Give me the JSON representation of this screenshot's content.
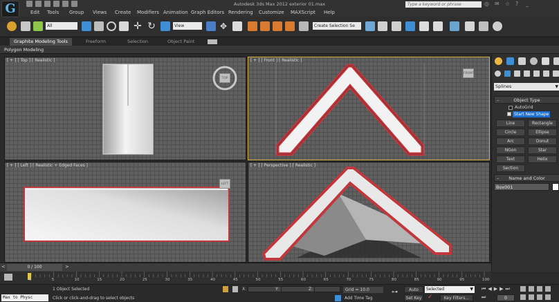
{
  "window": {
    "title": "Autodesk 3ds Max 2012    exterior 01.max",
    "search_placeholder": "Type a keyword or phrase"
  },
  "menu": {
    "items": [
      "Edit",
      "Tools",
      "Group",
      "Views",
      "Create",
      "Modifiers",
      "Animation",
      "Graph Editors",
      "Rendering",
      "Customize",
      "MAXScript",
      "Help"
    ]
  },
  "toolbar": {
    "filter_value": "All",
    "view_value": "View",
    "selection_set_placeholder": "Create Selection Se"
  },
  "ribbon": {
    "tabs": [
      "Graphite Modeling Tools",
      "Freeform",
      "Selection",
      "Object Paint"
    ],
    "subtab": "Polygon Modeling"
  },
  "viewports": {
    "top_label": "[ + ] [ Top ] [ Realistic ]",
    "front_label": "[ + ] [ Front ] [ Realistic ]",
    "left_label": "[ + ] [ Left ] [ Realistic + Edged Faces ]",
    "persp_label": "[ + ] [ Perspective ] [ Realistic ]",
    "viewcube_top": "TOP",
    "viewcube_front": "FRONT",
    "viewcube_left": "LEFT"
  },
  "command_panel": {
    "category": "Splines",
    "object_type_title": "Object Type",
    "autogrid_label": "AutoGrid",
    "start_new_shape": "Start New Shape",
    "shapes": [
      "Line",
      "Rectangle",
      "Circle",
      "Ellipse",
      "Arc",
      "Donut",
      "NGon",
      "Star",
      "Text",
      "Helix",
      "Section"
    ],
    "name_color_title": "Name and Color",
    "object_name": "Box001",
    "swatch_color": "#ffffff"
  },
  "timeline": {
    "frame_display": "0 / 100",
    "ticks": [
      "0",
      "5",
      "10",
      "15",
      "20",
      "25",
      "30",
      "35",
      "40",
      "45",
      "50",
      "55",
      "60",
      "65",
      "70",
      "75",
      "80",
      "85",
      "90",
      "95",
      "100"
    ]
  },
  "status": {
    "maxscript_label": "Max to Physc",
    "selected_text": "1 Object Selected",
    "prompt_text": "Click or click-and-drag to select objects",
    "x_label": "X:",
    "y_label": "Y:",
    "z_label": "Z:",
    "grid_text": "Grid = 10.0",
    "add_time_tag": "Add Time Tag",
    "auto_key": "Auto Key",
    "set_key": "Set Key",
    "selected_dropdown": "Selected",
    "key_filters": "Key Filters...",
    "current_frame": "0"
  },
  "colors": {
    "viewport_active_border": "#d6b13b",
    "roof_outline": "#c0383d",
    "accent_blue": "#1e6fd0"
  }
}
